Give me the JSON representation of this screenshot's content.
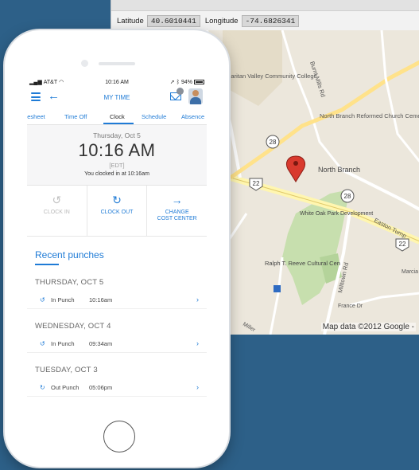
{
  "map_window": {
    "latitude_label": "Latitude",
    "latitude_value": "40.6010441",
    "longitude_label": "Longitude",
    "longitude_value": "-74.6826341",
    "credit": "Map data ©2012 Google -",
    "places": {
      "college": "Raritan Valley Community College",
      "burnt_mills": "Burnt Mills Rd",
      "church": "North Branch Reformed Church Cemetery",
      "north_branch": "North Branch",
      "white_oak": "White Oak Park Development",
      "easton": "Easton Turnp",
      "reeve": "Ralph T. Reeve Cultural Cen",
      "millown": "Milltown Rd",
      "france": "France Dr",
      "marcia": "Marcia",
      "rt28a": "28",
      "rt28b": "28",
      "rt22a": "22",
      "rt22b": "22",
      "miller": "Miller"
    }
  },
  "phone": {
    "status": {
      "carrier": "AT&T",
      "time": "10:16 AM",
      "battery": "94%"
    },
    "header": {
      "title": "MY TIME",
      "mail_count": ""
    },
    "tabs": [
      "mesheet",
      "Time Off",
      "Clock",
      "Schedule",
      "Absence"
    ],
    "clock": {
      "date": "Thursday, Oct 5",
      "time": "10:16 AM",
      "timezone": "[EDT]",
      "status": "You clocked in at 10:16am"
    },
    "actions": {
      "clock_in": "CLOCK IN",
      "clock_out": "CLOCK OUT",
      "change_cost_center_line1": "CHANGE",
      "change_cost_center_line2": "COST CENTER"
    },
    "recent_title": "Recent punches",
    "days": [
      {
        "header": "THURSDAY, OCT 5",
        "punch": {
          "type": "In Punch",
          "time": "10:16am"
        }
      },
      {
        "header": "WEDNESDAY, OCT 4",
        "punch": {
          "type": "In Punch",
          "time": "09:34am"
        }
      },
      {
        "header": "TUESDAY, OCT 3",
        "punch": {
          "type": "Out Punch",
          "time": "05:06pm"
        }
      }
    ]
  }
}
